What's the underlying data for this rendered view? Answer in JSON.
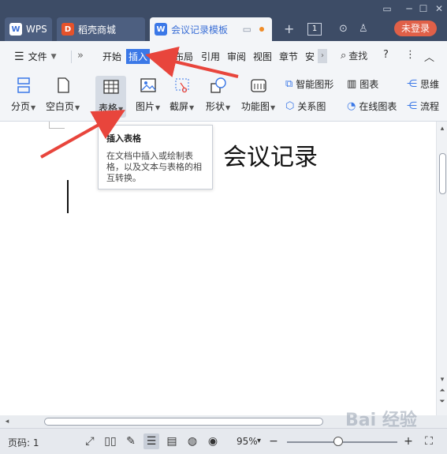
{
  "tabs": [
    {
      "label": "WPS"
    },
    {
      "label": "稻壳商城"
    },
    {
      "label": "会议记录模板"
    }
  ],
  "tab_counter": "1",
  "login_label": "未登录",
  "menu": {
    "file": "文件",
    "items": [
      "开始",
      "插入",
      "页面布局",
      "引用",
      "审阅",
      "视图",
      "章节",
      "安"
    ],
    "search": "查找"
  },
  "ribbon": {
    "page_break": "分页",
    "blank_page": "空白页",
    "table": "表格",
    "picture": "图片",
    "screenshot": "截屏",
    "shapes": "形状",
    "function_chart": "功能图",
    "smart_art": "智能图形",
    "chart": "图表",
    "relation_chart": "关系图",
    "online_chart": "在线图表",
    "mind": "思维",
    "flow": "流程"
  },
  "tooltip": {
    "title": "插入表格",
    "body": "在文档中插入或绘制表格，以及文本与表格的相互转换。"
  },
  "document": {
    "title": "会议记录"
  },
  "status": {
    "page_label": "页码: 1",
    "zoom": "95%"
  },
  "watermark": "Bai 经验",
  "colors": {
    "titlebar": "#3d4c66",
    "accent": "#3b78e7",
    "login": "#e06048",
    "arrow": "#e8453c"
  }
}
